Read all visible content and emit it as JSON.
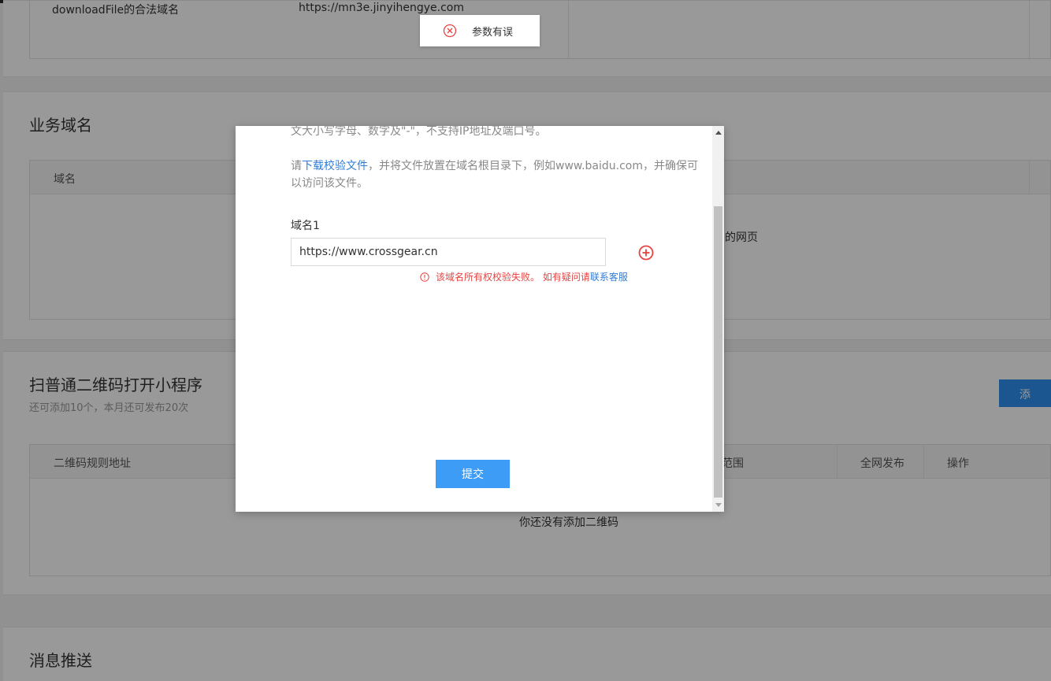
{
  "legal_domain_row": {
    "name": "downloadFile的合法域名",
    "value": "https://mn3e.jinyihengye.com"
  },
  "business_domain": {
    "title": "业务域名",
    "col_domain": "域名",
    "partial_text": "的网页"
  },
  "qrcode_section": {
    "title": "扫普通二维码打开小程序",
    "subtitle": "还可添加10个，本月还可发布20次",
    "add_button": "添",
    "columns": [
      "二维码规则地址",
      "范围",
      "全网发布",
      "操作"
    ],
    "empty_text": "你还没有添加二维码"
  },
  "message_push": {
    "title": "消息推送"
  },
  "modal": {
    "top_text": "文大小写字母、数字及\"-\"，不支持IP地址及端口号。",
    "note_prefix": "请",
    "note_link": "下载校验文件",
    "note_rest": "，并将文件放置在域名根目录下，例如www.baidu.com，并确保可以访问该文件。",
    "field_label": "域名1",
    "field_value": "https://www.crossgear.cn",
    "error_text": "该域名所有权校验失败。 如有疑问请",
    "error_link": "联系客服",
    "submit_label": "提交"
  },
  "toast": {
    "message": "参数有误"
  },
  "colors": {
    "primary": "#3c9cf6",
    "error": "#e64340",
    "link": "#2f7dd8"
  }
}
